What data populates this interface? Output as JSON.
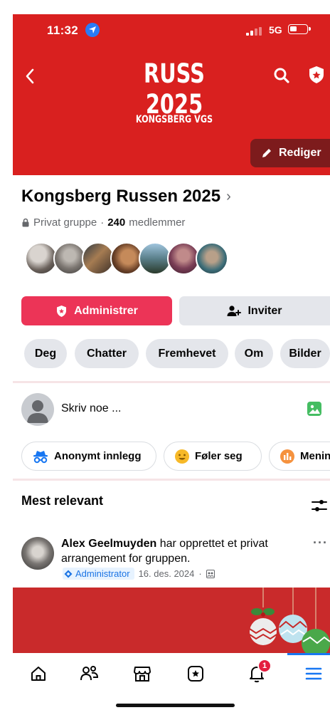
{
  "status_bar": {
    "time": "11:32",
    "network": "5G"
  },
  "cover": {
    "title": "RUSS 2025",
    "subtitle": "KONGSBERG VGS",
    "edit_label": "Rediger",
    "color": "#d9201f"
  },
  "group": {
    "name": "Kongsberg Russen 2025",
    "privacy": "Privat gruppe",
    "separator": "·",
    "member_count": "240",
    "member_label": "medlemmer"
  },
  "actions": {
    "admin_label": "Administrer",
    "invite_label": "Inviter",
    "admin_color": "#ec3457"
  },
  "tabs": [
    {
      "label": "Deg"
    },
    {
      "label": "Chatter"
    },
    {
      "label": "Fremhevet"
    },
    {
      "label": "Om"
    },
    {
      "label": "Bilder"
    }
  ],
  "composer": {
    "placeholder": "Skriv noe ..."
  },
  "chips": [
    {
      "label": "Anonymt innlegg",
      "icon": "incognito-icon"
    },
    {
      "label": "Føler seg",
      "icon": "smiley-icon"
    },
    {
      "label": "Menin",
      "icon": "poll-icon"
    }
  ],
  "feed": {
    "sort_label": "Mest relevant"
  },
  "post": {
    "author": "Alex Geelmuyden",
    "action": "har opprettet et privat arrangement for gruppen.",
    "badge": "Administrator",
    "date": "16. des. 2024",
    "dot": "·",
    "more": "···"
  },
  "bottom_nav": {
    "items": [
      {
        "icon": "home-icon"
      },
      {
        "icon": "groups-icon"
      },
      {
        "icon": "marketplace-icon"
      },
      {
        "icon": "feeds-icon"
      },
      {
        "icon": "bell-icon"
      },
      {
        "icon": "menu-icon"
      }
    ],
    "notification_count": "1",
    "active": "menu-icon",
    "accent": "#1877f2"
  }
}
